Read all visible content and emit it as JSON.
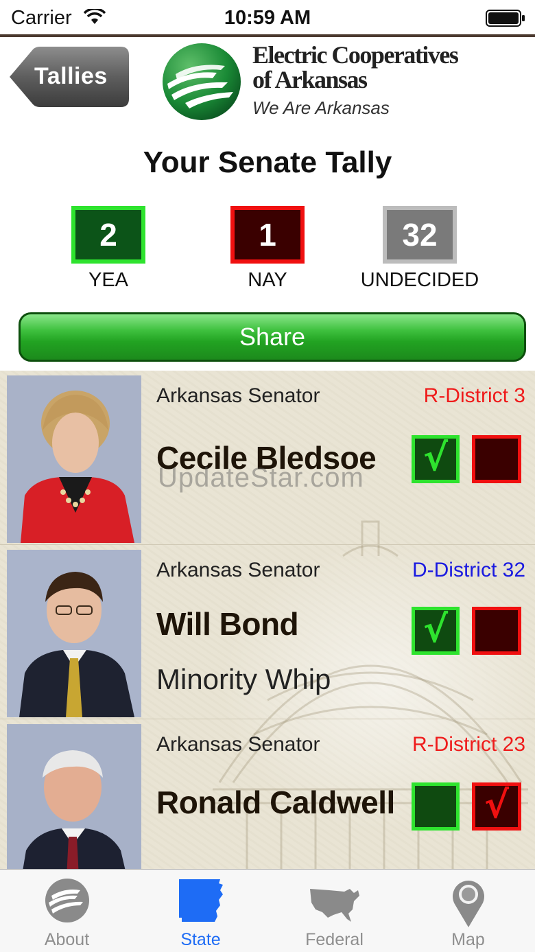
{
  "status_bar": {
    "carrier": "Carrier",
    "time": "10:59 AM"
  },
  "header": {
    "back_label": "Tallies",
    "brand_line1": "Electric Cooperatives",
    "brand_line2": "of Arkansas",
    "tagline": "We Are Arkansas"
  },
  "page_title": "Your Senate Tally",
  "tally": {
    "yea_count": "2",
    "yea_label": "YEA",
    "nay_count": "1",
    "nay_label": "NAY",
    "undecided_count": "32",
    "undecided_label": "UNDECIDED"
  },
  "share_label": "Share",
  "watermark": "UpdateStar.com",
  "senators": [
    {
      "role": "Arkansas Senator",
      "district": "R-District 3",
      "party_color": "#ef1b1b",
      "name": "Cecile Bledsoe",
      "subtitle": "",
      "vote": "yea"
    },
    {
      "role": "Arkansas Senator",
      "district": "D-District 32",
      "party_color": "#1a1ae0",
      "name": "Will Bond",
      "subtitle": "Minority Whip",
      "vote": "yea"
    },
    {
      "role": "Arkansas Senator",
      "district": "R-District 23",
      "party_color": "#ef1b1b",
      "name": "Ronald Caldwell",
      "subtitle": "",
      "vote": "nay"
    }
  ],
  "vote_mark": "√",
  "tabs": [
    {
      "label": "About",
      "icon": "co-op-logo-icon",
      "active": false
    },
    {
      "label": "State",
      "icon": "arkansas-map-icon",
      "active": true
    },
    {
      "label": "Federal",
      "icon": "usa-map-icon",
      "active": false
    },
    {
      "label": "Map",
      "icon": "map-pin-icon",
      "active": false
    }
  ],
  "colors": {
    "tab_active": "#1e6cf5",
    "tab_inactive": "#8e8e8e",
    "yea_border": "#2ee32e",
    "nay_border": "#f01010"
  }
}
